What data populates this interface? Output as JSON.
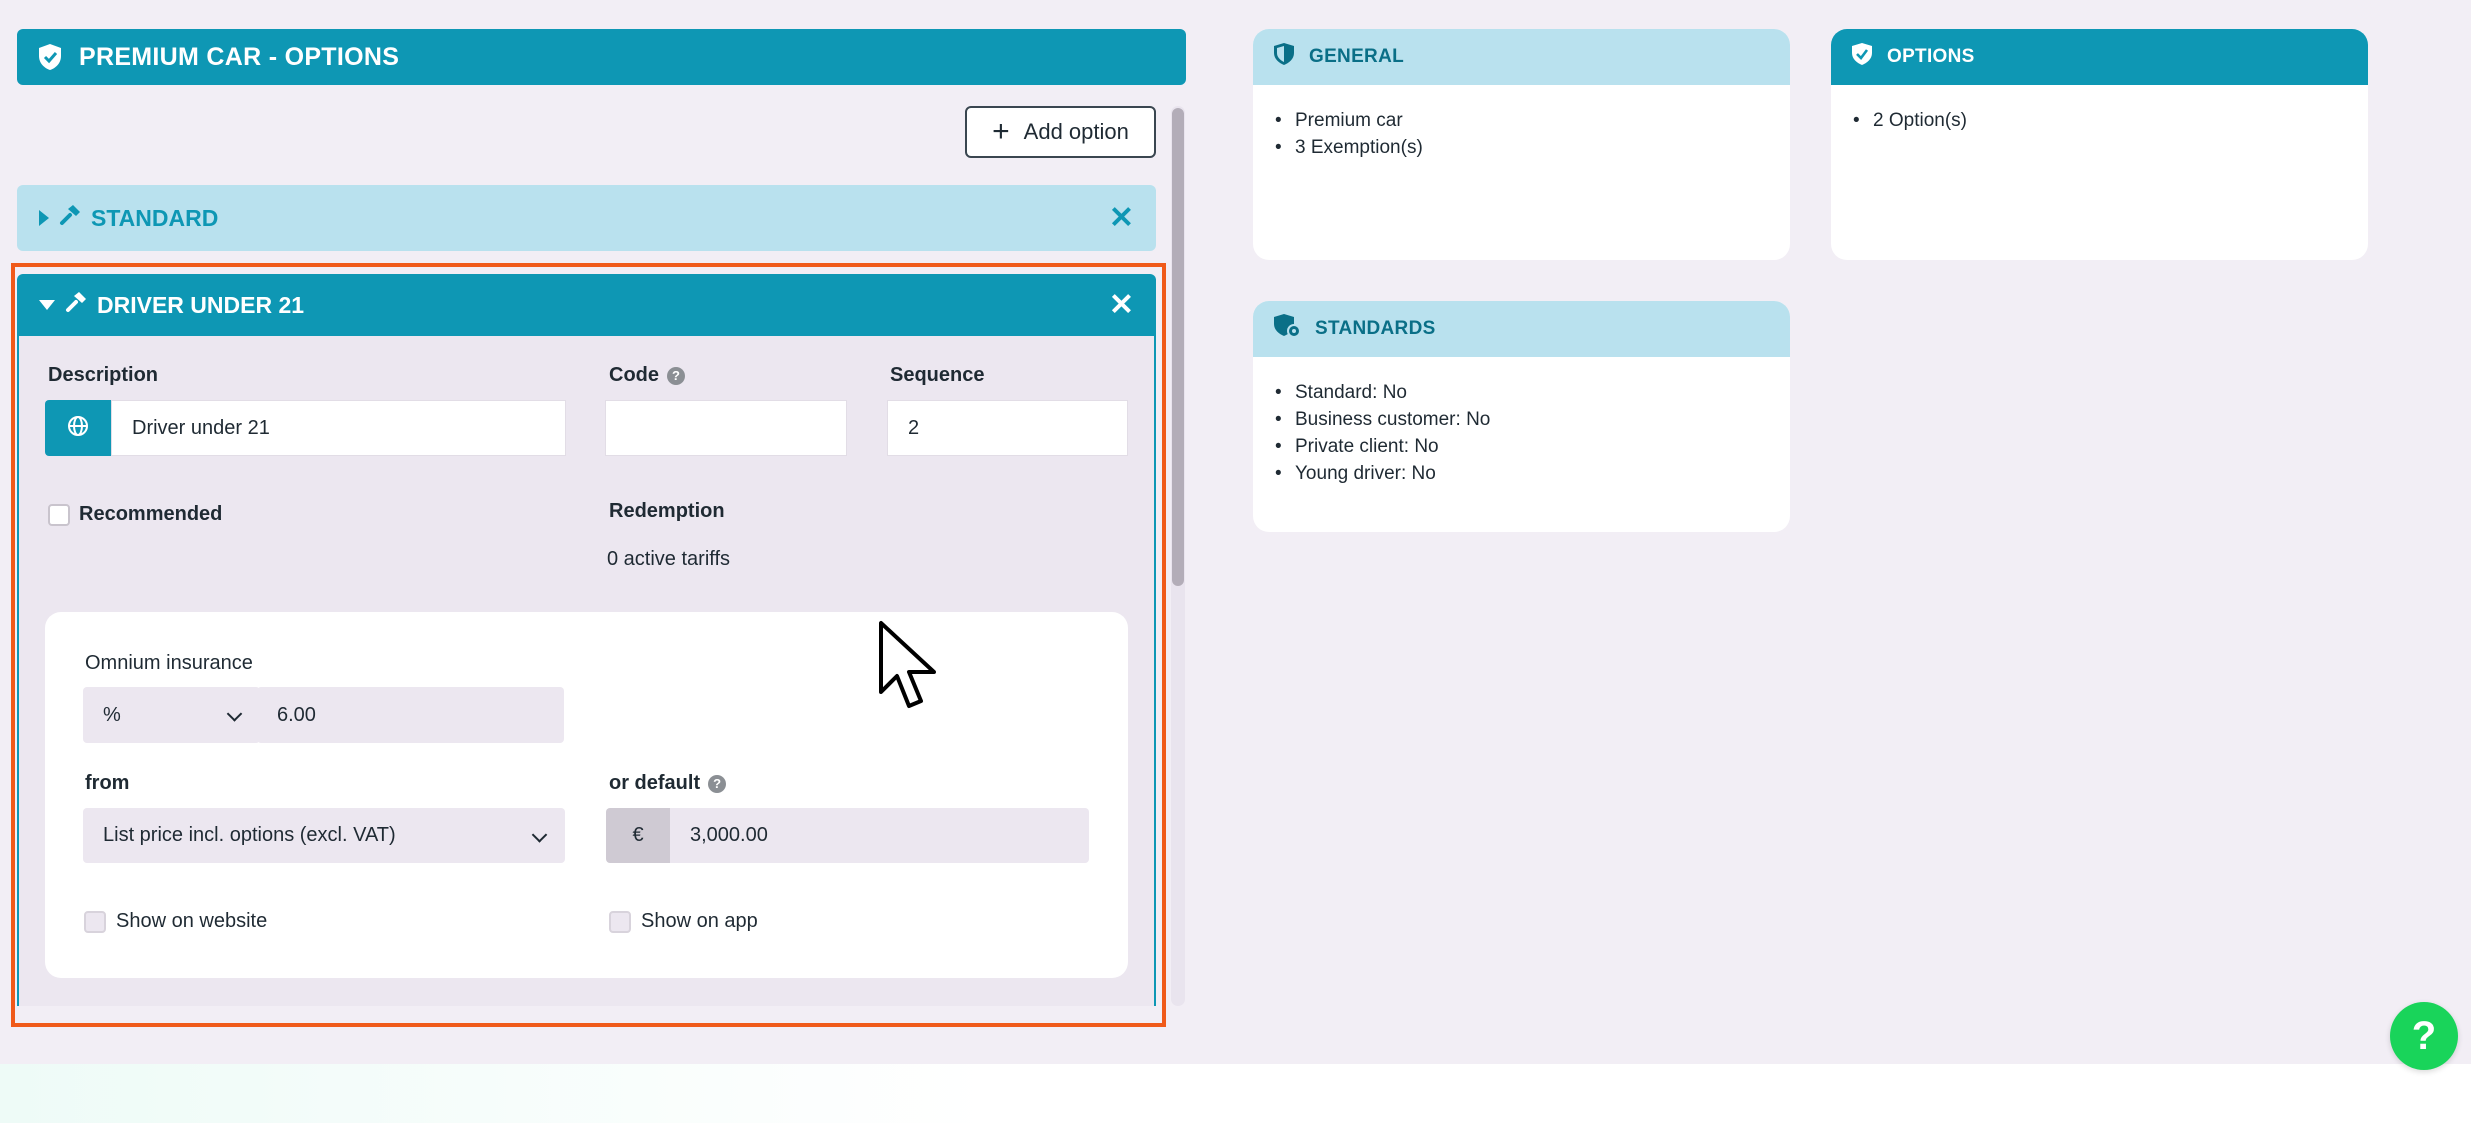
{
  "header": {
    "title": "PREMIUM CAR - OPTIONS"
  },
  "toolbar": {
    "add_option_label": "Add option"
  },
  "accordions": {
    "standard": {
      "title": "STANDARD"
    },
    "driver": {
      "title": "DRIVER UNDER 21"
    }
  },
  "form": {
    "description_label": "Description",
    "description_value": "Driver under 21",
    "code_label": "Code",
    "code_value": "",
    "sequence_label": "Sequence",
    "sequence_value": "2",
    "recommended_label": "Recommended",
    "redemption_label": "Redemption",
    "redemption_value": "0 active tariffs",
    "omnium_label": "Omnium insurance",
    "omnium_unit": "%",
    "omnium_value": "6.00",
    "from_label": "from",
    "from_value": "List price incl. options (excl. VAT)",
    "default_label": "or default",
    "currency_symbol": "€",
    "default_value": "3,000.00",
    "show_website_label": "Show on website",
    "show_app_label": "Show on app"
  },
  "cards": {
    "general": {
      "title": "GENERAL",
      "items": [
        "Premium car",
        "3 Exemption(s)"
      ]
    },
    "options": {
      "title": "OPTIONS",
      "items": [
        "2 Option(s)"
      ]
    },
    "standards": {
      "title": "STANDARDS",
      "items": [
        {
          "label": "Standard:",
          "value": "No"
        },
        {
          "label": "Business customer:",
          "value": "No"
        },
        {
          "label": "Private client:",
          "value": "No"
        },
        {
          "label": "Young driver:",
          "value": "No"
        }
      ]
    }
  },
  "help": {
    "label": "?"
  },
  "colors": {
    "primary": "#0e97b4",
    "light": "#b9e1ee",
    "highlight": "#f05a1a",
    "help": "#19d45a"
  }
}
